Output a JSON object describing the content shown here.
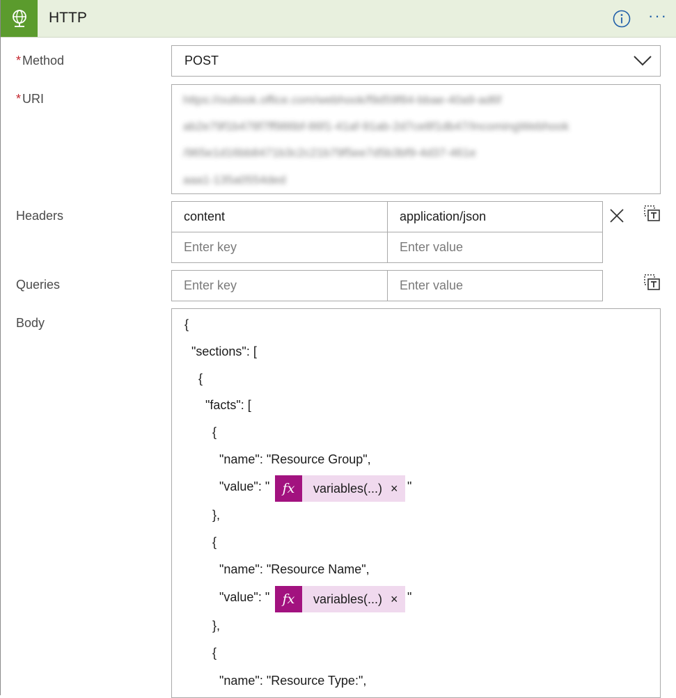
{
  "header": {
    "title": "HTTP",
    "icon": "globe-icon",
    "more_label": "···",
    "accent": "#5b9b2d",
    "bg": "#e8f0de"
  },
  "method": {
    "label": "Method",
    "required_mark": "*",
    "value": "POST"
  },
  "uri": {
    "label": "URI",
    "required_mark": "*",
    "lines": [
      "https://outlook.office.com/webhook/f9d59f84-bbae-40a9-ad6f",
      "ab2e79f1b478f7ff986bf-86f1-41af-91ab-2d7ce8f1db47/IncomingWebhook",
      "/965e1d16bb8471b3c2c21b79f5ee7d5b3bf9-4d37-461e",
      "aaa1-135a0554ded"
    ]
  },
  "headers": {
    "label": "Headers",
    "rows": [
      {
        "key": "content",
        "value": "application/json"
      }
    ],
    "key_placeholder": "Enter key",
    "value_placeholder": "Enter value"
  },
  "queries": {
    "label": "Queries",
    "key_placeholder": "Enter key",
    "value_placeholder": "Enter value"
  },
  "body": {
    "label": "Body",
    "lines": [
      "{",
      "  \"sections\": [",
      "    {",
      "      \"facts\": [",
      "        {",
      "          \"name\": \"Resource Group\",",
      "          \"value\": \"",
      "        },",
      "        {",
      "          \"name\": \"Resource Name\",",
      "          \"value\": \"",
      "        },",
      "        {",
      "          \"name\": \"Resource Type:\","
    ],
    "token_label": "variables(...)",
    "token_fx": "fx",
    "token_close": "×",
    "quote_close": "\""
  }
}
